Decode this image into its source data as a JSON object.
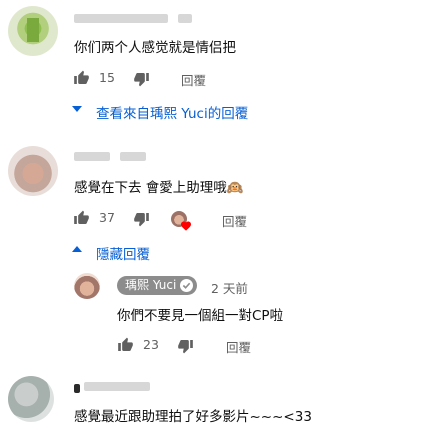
{
  "comments": [
    {
      "author": "",
      "text": "你们两个人感觉就是情侣把",
      "likes": "15",
      "reply_label": "回覆",
      "replies_toggle": "查看來自瑀熙 Yuci的回覆"
    },
    {
      "author": "",
      "text": "感覺在下去 會愛上助理哦🙉",
      "likes": "37",
      "reply_label": "回覆",
      "replies_toggle": "隱藏回覆",
      "creator_hearted": true
    },
    {
      "author": "",
      "text": "感覺最近跟助理拍了好多影片~~~<33"
    }
  ],
  "reply": {
    "author": "瑀熙 Yuci",
    "time": "2 天前",
    "text": "你們不要見一個組一對CP啦",
    "likes": "23",
    "reply_label": "回覆"
  },
  "colors": {
    "link_blue": "#065fd4",
    "meta_gray": "#606060",
    "heart_red": "#ff0000",
    "badge_gray": "#8c8c8c"
  },
  "icons": [
    "thumb-up-icon",
    "thumb-down-icon",
    "caret-down-icon",
    "caret-up-icon",
    "verified-check-icon",
    "heart-icon"
  ]
}
